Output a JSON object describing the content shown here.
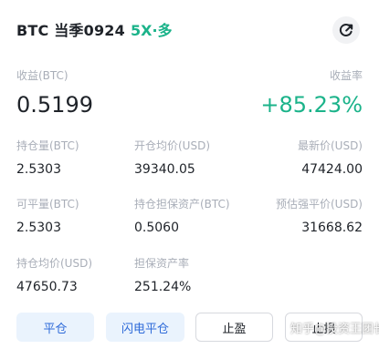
{
  "header": {
    "title": "BTC 当季0924",
    "leverage": "5X·多"
  },
  "summary": {
    "pnl_label": "收益(BTC)",
    "pnl_value": "0.5199",
    "roe_label": "收益率",
    "roe_value": "+85.23%"
  },
  "row1": [
    {
      "label": "持仓量(BTC)",
      "value": "2.5303"
    },
    {
      "label": "开仓均价(USD)",
      "value": "39340.05"
    },
    {
      "label": "最新价(USD)",
      "value": "47424.00"
    }
  ],
  "row2": [
    {
      "label": "可平量(BTC)",
      "value": "2.5303"
    },
    {
      "label": "持仓担保资产(BTC)",
      "value": "0.5060"
    },
    {
      "label": "预估强平价(USD)",
      "value": "31668.62"
    }
  ],
  "row3": [
    {
      "label": "持仓均价(USD)",
      "value": "47650.73"
    },
    {
      "label": "担保资产率",
      "value": "251.24%"
    }
  ],
  "buttons": {
    "close": "平仓",
    "flash_close": "闪电平仓",
    "take_profit": "止盈",
    "stop_loss": "止损"
  },
  "watermark": "知乎@投资王团长",
  "colors": {
    "green": "#1bb38a",
    "blue_text": "#2f6bd9",
    "blue_bg": "#eaf3fd",
    "label_gray": "#a9aeb8"
  }
}
